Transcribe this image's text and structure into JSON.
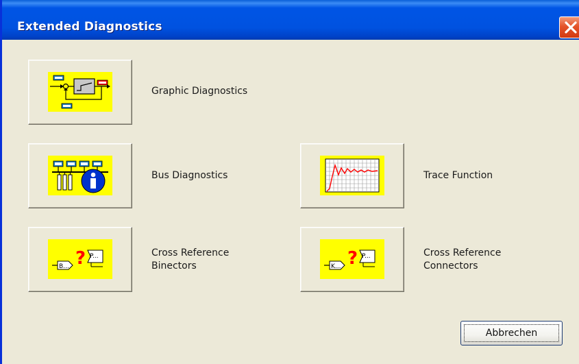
{
  "window": {
    "title": "Extended Diagnostics"
  },
  "buttons": {
    "graphic_diagnostics": "Graphic Diagnostics",
    "bus_diagnostics": "Bus Diagnostics",
    "trace_function": "Trace Function",
    "cross_ref_binectors_line1": "Cross Reference",
    "cross_ref_binectors_line2": "Binectors",
    "cross_ref_connectors_line1": "Cross Reference",
    "cross_ref_connectors_line2": "Connectors",
    "cancel": "Abbrechen"
  },
  "icons": {
    "graphic_diagnostics": "block-diagram-icon",
    "bus_diagnostics": "bus-info-icon",
    "trace_function": "trace-graph-icon",
    "cross_ref_binectors": "binector-crossref-icon",
    "cross_ref_connectors": "connector-crossref-icon",
    "close": "close-icon",
    "binector_tag": "B...",
    "connector_tag": "K...",
    "param_tag": "P...",
    "question_mark": "?"
  },
  "colors": {
    "title_bar": "#0055e5",
    "close_button": "#e4532a",
    "icon_background": "#ffff00",
    "window_background": "#ece9d8"
  }
}
